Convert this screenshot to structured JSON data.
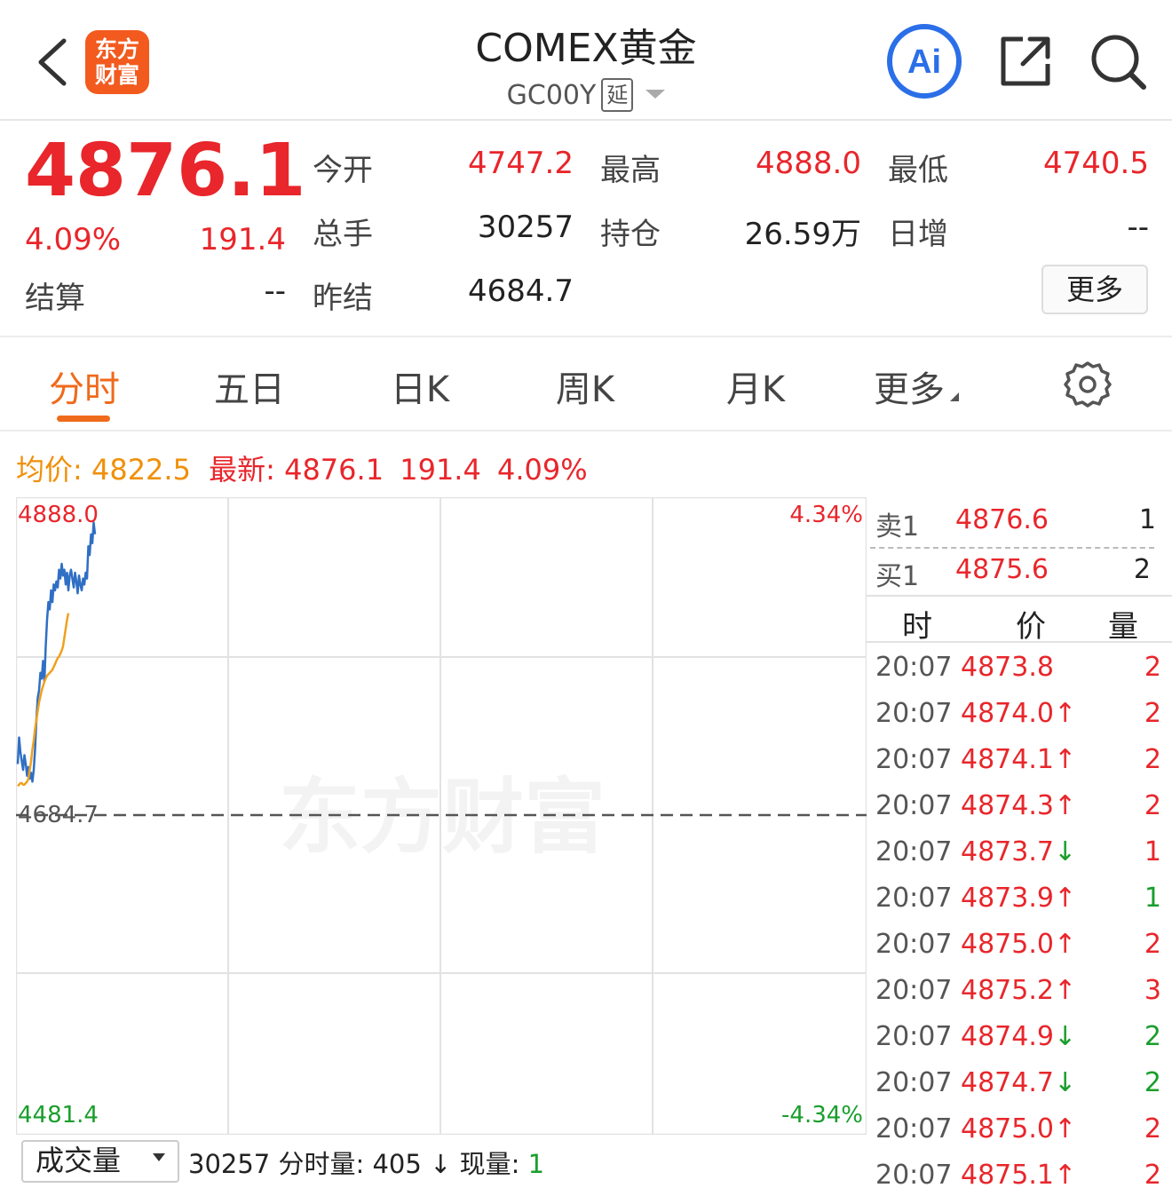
{
  "header": {
    "title": "COMEX黄金",
    "symbol": "GC00Y",
    "delay_badge": "延",
    "logo_line1": "东方",
    "logo_line2": "财富",
    "ai_label": "Ai"
  },
  "quote": {
    "last_price": "4876.1",
    "change_pct": "4.09%",
    "change_value": "191.4",
    "fields": [
      {
        "label": "今开",
        "value": "4747.2",
        "color": "red"
      },
      {
        "label": "最高",
        "value": "4888.0",
        "color": "red"
      },
      {
        "label": "最低",
        "value": "4740.5",
        "color": "red"
      },
      {
        "label": "总手",
        "value": "30257",
        "color": "black"
      },
      {
        "label": "持仓",
        "value": "26.59万",
        "color": "black"
      },
      {
        "label": "日增",
        "value": "--",
        "color": "black"
      },
      {
        "label": "结算",
        "value": "--",
        "color": "black"
      },
      {
        "label": "昨结",
        "value": "4684.7",
        "color": "black"
      }
    ],
    "more_label": "更多"
  },
  "tabs": [
    {
      "label": "分时",
      "active": true
    },
    {
      "label": "五日",
      "active": false
    },
    {
      "label": "日K",
      "active": false
    },
    {
      "label": "周K",
      "active": false
    },
    {
      "label": "月K",
      "active": false
    },
    {
      "label": "更多",
      "active": false
    }
  ],
  "info_line": {
    "avg_label": "均价:",
    "avg_value": "4822.5",
    "latest_label": "最新:",
    "latest_value": "4876.1",
    "latest_change": "191.4",
    "latest_pct": "4.09%"
  },
  "chart_data": {
    "type": "line",
    "y_high_label": "4888.0",
    "y_mid_label": "4684.7",
    "y_low_label": "4481.4",
    "pct_high_label": "4.34%",
    "pct_low_label": "-4.34%",
    "ylim": [
      4481.4,
      4888.0
    ],
    "reference": 4684.7,
    "watermark": "东方财富",
    "series": [
      {
        "color": "#2f6fc4",
        "values": [
          4720,
          4738,
          4728,
          4722,
          4716,
          4726,
          4720,
          4712,
          4718,
          4710,
          4714,
          4708,
          4716,
          4730,
          4750,
          4765,
          4770,
          4782,
          4778,
          4790,
          4776,
          4800,
          4818,
          4830,
          4825,
          4838,
          4830,
          4842,
          4838,
          4844,
          4840,
          4852,
          4846,
          4856,
          4848,
          4852,
          4842,
          4850,
          4838,
          4848,
          4852,
          4846,
          4840,
          4850,
          4844,
          4836,
          4848,
          4842,
          4838,
          4846,
          4842,
          4850,
          4846,
          4868,
          4862,
          4876,
          4870,
          4884,
          4876.1
        ]
      },
      {
        "color": "#f0a020",
        "values": [
          4705,
          4706,
          4707,
          4707,
          4706,
          4706,
          4707,
          4708,
          4710,
          4716,
          4722,
          4730,
          4736,
          4744,
          4750,
          4756,
          4762,
          4766,
          4770,
          4773,
          4776,
          4778,
          4780,
          4781,
          4782,
          4783,
          4784,
          4786,
          4788,
          4790,
          4792,
          4793,
          4795,
          4797,
          4800,
          4806,
          4812,
          4818,
          4822.5
        ]
      }
    ]
  },
  "order_book": {
    "ask": {
      "label": "卖1",
      "price": "4876.6",
      "qty": "1"
    },
    "bid": {
      "label": "买1",
      "price": "4875.6",
      "qty": "2"
    },
    "headers": [
      "时",
      "价",
      "量"
    ],
    "trades": [
      {
        "time": "20:07",
        "price": "4873.8",
        "arrow": "",
        "qty": "2",
        "qty_color": "red"
      },
      {
        "time": "20:07",
        "price": "4874.0",
        "arrow": "↑",
        "qty": "2",
        "qty_color": "red"
      },
      {
        "time": "20:07",
        "price": "4874.1",
        "arrow": "↑",
        "qty": "2",
        "qty_color": "red"
      },
      {
        "time": "20:07",
        "price": "4874.3",
        "arrow": "↑",
        "qty": "2",
        "qty_color": "red"
      },
      {
        "time": "20:07",
        "price": "4873.7",
        "arrow": "↓",
        "qty": "1",
        "qty_color": "red"
      },
      {
        "time": "20:07",
        "price": "4873.9",
        "arrow": "↑",
        "qty": "1",
        "qty_color": "green"
      },
      {
        "time": "20:07",
        "price": "4875.0",
        "arrow": "↑",
        "qty": "2",
        "qty_color": "red"
      },
      {
        "time": "20:07",
        "price": "4875.2",
        "arrow": "↑",
        "qty": "3",
        "qty_color": "red"
      },
      {
        "time": "20:07",
        "price": "4874.9",
        "arrow": "↓",
        "qty": "2",
        "qty_color": "green"
      },
      {
        "time": "20:07",
        "price": "4874.7",
        "arrow": "↓",
        "qty": "2",
        "qty_color": "green"
      },
      {
        "time": "20:07",
        "price": "4875.0",
        "arrow": "↑",
        "qty": "2",
        "qty_color": "red"
      },
      {
        "time": "20:07",
        "price": "4875.1",
        "arrow": "↑",
        "qty": "2",
        "qty_color": "red"
      }
    ]
  },
  "volume_bar": {
    "selector_label": "成交量",
    "total": "30257",
    "minute_label": "分时量:",
    "minute_value": "405",
    "minute_arrow": "↓",
    "current_label": "现量:",
    "current_value": "1"
  },
  "colors": {
    "up": "#e8262b",
    "down": "#1a9e2c",
    "accent": "#ef6a1b",
    "price_line": "#2f6fc4",
    "avg_line": "#f0a020"
  },
  "icons": [
    "back-chevron-icon",
    "app-logo",
    "ai-icon",
    "share-icon",
    "search-icon",
    "settings-gear-icon",
    "dropdown-caret-icon"
  ]
}
